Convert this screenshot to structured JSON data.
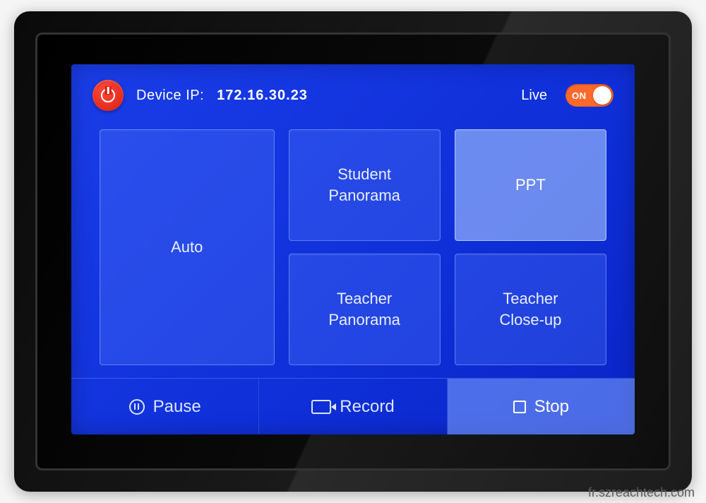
{
  "header": {
    "ip_label": "Device IP:",
    "ip_value": "172.16.30.23",
    "live_label": "Live",
    "toggle_state": "ON"
  },
  "modes": {
    "auto": "Auto",
    "student_panorama": "Student\nPanorama",
    "ppt": "PPT",
    "teacher_panorama": "Teacher\nPanorama",
    "teacher_closeup": "Teacher\nClose-up"
  },
  "footer": {
    "pause": "Pause",
    "record": "Record",
    "stop": "Stop"
  },
  "watermark": "fr.szreachtech.com"
}
